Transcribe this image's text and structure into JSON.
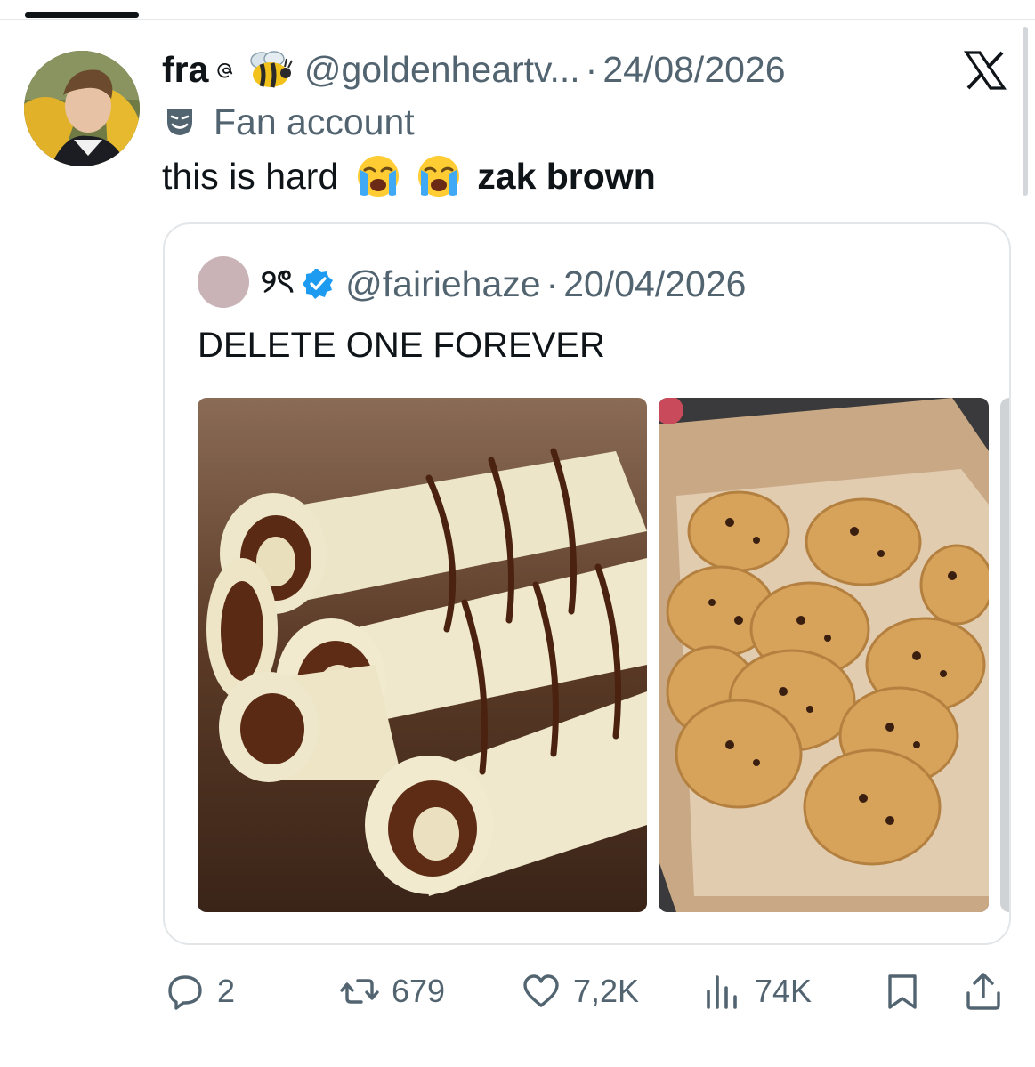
{
  "tweet": {
    "display_name": "fra",
    "name_glyph": "ဇ",
    "handle": "@goldenheartv...",
    "separator": "·",
    "date": "24/08/2026",
    "badge_label": "Fan account",
    "text": "this is hard",
    "text_bold": "zak brown"
  },
  "quote": {
    "display_name": "୨ৎ",
    "handle": "@fairiehaze",
    "separator": "·",
    "date": "20/04/2026",
    "text": "DELETE ONE FOREVER",
    "media": [
      "crepes-with-chocolate-photo",
      "chocolate-chip-cookies-photo"
    ]
  },
  "actions": {
    "replies": "2",
    "reposts": "679",
    "likes": "7,2K",
    "views": "74K"
  },
  "icons": {
    "brand": "x-logo-icon",
    "badge": "theater-mask-icon",
    "verified": "verified-badge-icon"
  },
  "colors": {
    "text": "#0f1419",
    "muted": "#536471",
    "verified": "#1d9bf0",
    "border": "#e3e6e9"
  }
}
